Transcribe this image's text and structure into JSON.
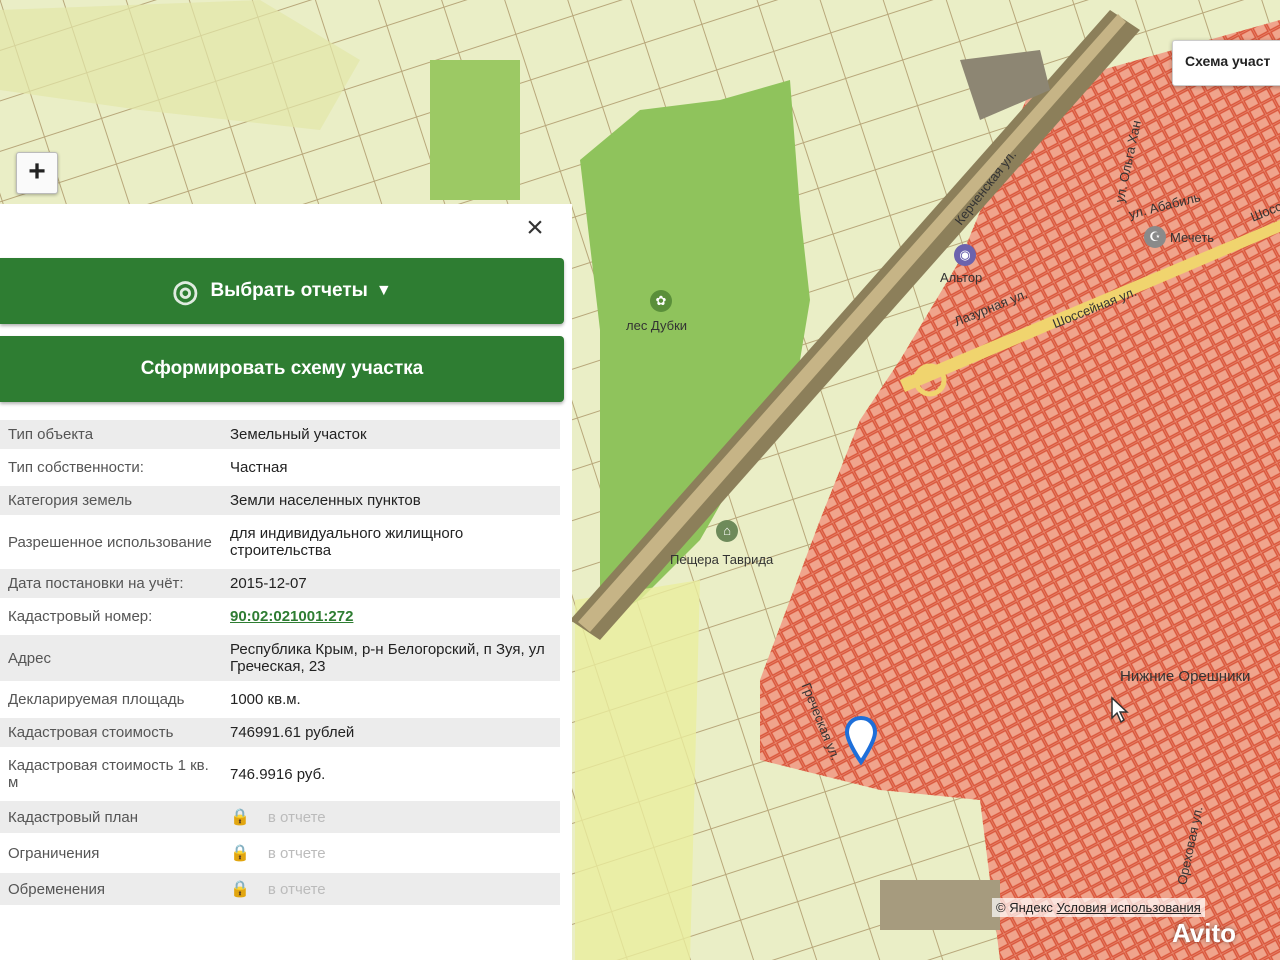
{
  "map": {
    "zoom_in_label": "+",
    "scheme_button_label": "Схема участ",
    "labels": {
      "forest": "лес Дубки",
      "cave": "Пещера Таврида",
      "street_kerchenskaya": "Керченская ул.",
      "street_otkhan": "ул. Ольга Хан",
      "street_ababil": "ул. Абабиль",
      "mosque": "Мечеть",
      "altor": "Альтор",
      "street_shosseynaya": "Шоссейная ул.",
      "shos": "Шосс",
      "lazurnaya": "Лазурная ул.",
      "village": "Нижние Орешники",
      "street_greek": "Греческая ул.",
      "street_orekhovaya": "Ореховая ул."
    },
    "colors": {
      "farmland": "#e6ecc4",
      "forest_green": "#8ec45a",
      "urban_red": "#e8826c",
      "road": "#9a8a64"
    }
  },
  "panel": {
    "close_label": "×",
    "select_reports_label": "Выбрать отчеты",
    "caret": "▼",
    "generate_scheme_label": "Сформировать схему участка",
    "rows": [
      {
        "key": "Тип объекта",
        "value": "Земельный участок"
      },
      {
        "key": "Тип собственности:",
        "value": "Частная"
      },
      {
        "key": "Категория земель",
        "value": "Земли населенных пунктов"
      },
      {
        "key": "Разрешенное использование",
        "value": "для индивидуального жилищного строительства"
      },
      {
        "key": "Дата постановки на учёт:",
        "value": "2015-12-07"
      },
      {
        "key": "Кадастровый номер:",
        "value": "90:02:021001:272"
      },
      {
        "key": "Адрес",
        "value": "Республика Крым, р-н Белогорский, п Зуя, ул Греческая, 23"
      },
      {
        "key": "Декларируемая площадь",
        "value": "1000 кв.м."
      },
      {
        "key": "Кадастровая стоимость",
        "value": "746991.61 рублей"
      },
      {
        "key": "Кадастровая стоимость 1 кв. м",
        "value": "746.9916 руб."
      },
      {
        "key": "Кадастровый план",
        "value": "в отчете"
      },
      {
        "key": "Ограничения",
        "value": "в отчете"
      },
      {
        "key": "Обременения",
        "value": "в отчете"
      }
    ]
  },
  "footer": {
    "copyright": "© Яндекс",
    "terms_link": "Условия использования",
    "watermark": "Avito"
  }
}
